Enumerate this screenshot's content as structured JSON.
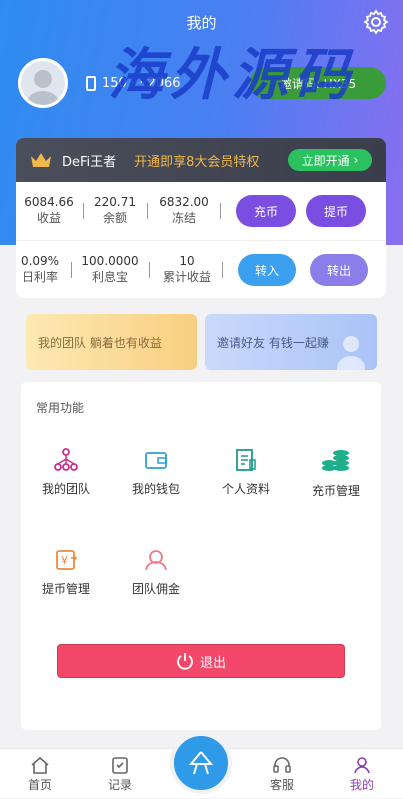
{
  "header": {
    "title": "我的",
    "watermark": "海外源码",
    "phone": "150 · · 2066",
    "invite_label": "邀请码: HX35"
  },
  "vip": {
    "name": "DeFi王者",
    "promo": "开通即享8大会员特权",
    "button": "立即开通"
  },
  "stats_row1": [
    {
      "value": "6084.66",
      "label": "收益"
    },
    {
      "value": "220.71",
      "label": "余额"
    },
    {
      "value": "6832.00",
      "label": "冻结"
    }
  ],
  "stats_row2": [
    {
      "value": "0.09%",
      "label": "日利率"
    },
    {
      "value": "100.0000",
      "label": "利息宝"
    },
    {
      "value": "10",
      "label": "累计收益"
    }
  ],
  "buttons": {
    "recharge": "充币",
    "withdraw": "提币",
    "transfer_in": "转入",
    "transfer_out": "转出"
  },
  "banners": {
    "team": "我的团队 躺着也有收益",
    "invite": "邀请好友 有钱一起赚"
  },
  "functions": {
    "title": "常用功能",
    "items": [
      {
        "label": "我的团队",
        "icon": "team-icon"
      },
      {
        "label": "我的钱包",
        "icon": "wallet-icon"
      },
      {
        "label": "个人资料",
        "icon": "profile-icon"
      },
      {
        "label": "充币管理",
        "icon": "coins-icon"
      },
      {
        "label": "提币管理",
        "icon": "withdraw-icon"
      },
      {
        "label": "团队佣金",
        "icon": "commission-icon"
      }
    ]
  },
  "logout": "退出",
  "tabbar": {
    "home": "首页",
    "records": "记录",
    "service": "客服",
    "mine": "我的"
  },
  "colors": {
    "accent": "#8a3fb0",
    "logout": "#f4486a",
    "green": "#2cc160",
    "purple": "#7a4ee0"
  }
}
